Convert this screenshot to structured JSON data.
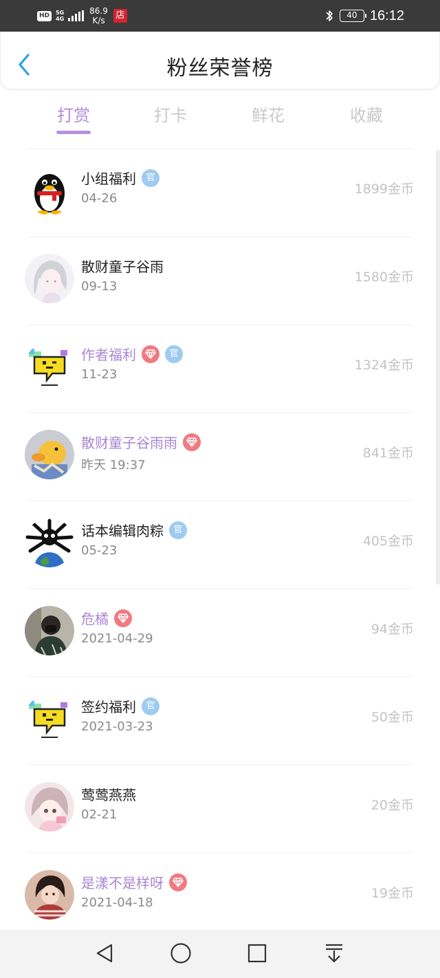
{
  "status_bar": {
    "hd": "HD",
    "network_type": "5G",
    "network_sub": "4G",
    "speed_value": "86.9",
    "speed_unit": "K/s",
    "shop_badge": "店",
    "battery": "40",
    "time": "16:12"
  },
  "header": {
    "title": "粉丝荣誉榜",
    "back_icon": "chevron-left-icon"
  },
  "tabs": [
    {
      "label": "打赏",
      "active": true
    },
    {
      "label": "打卡",
      "active": false
    },
    {
      "label": "鲜花",
      "active": false
    },
    {
      "label": "收藏",
      "active": false
    }
  ],
  "badges": {
    "guan": "官"
  },
  "colors": {
    "accent": "#b08bd9",
    "vip_name": "#a985d4",
    "guan_badge": "#9ecbf0",
    "diamond_badge": "#f07a80"
  },
  "fans": [
    {
      "name": "小组福利",
      "date": "04-26",
      "amount": "1899金币",
      "vip": false,
      "guan": true,
      "diamond": false,
      "avatar": "penguin-avatar"
    },
    {
      "name": "散财童子谷雨",
      "date": "09-13",
      "amount": "1580金币",
      "vip": false,
      "guan": false,
      "diamond": false,
      "avatar": "anime-girl-avatar"
    },
    {
      "name": "作者福利",
      "date": "11-23",
      "amount": "1324金币",
      "vip": true,
      "guan": true,
      "diamond": true,
      "avatar": "yellow-sign-avatar"
    },
    {
      "name": "散财童子谷雨雨",
      "date": "昨天 19:37",
      "amount": "841金币",
      "vip": true,
      "guan": false,
      "diamond": true,
      "avatar": "duck-avatar"
    },
    {
      "name": "话本编辑肉粽",
      "date": "05-23",
      "amount": "405金币",
      "vip": false,
      "guan": true,
      "diamond": false,
      "avatar": "globe-creature-avatar"
    },
    {
      "name": "危橘",
      "date": "2021-04-29",
      "amount": "94金币",
      "vip": true,
      "guan": false,
      "diamond": true,
      "avatar": "person-photo-avatar"
    },
    {
      "name": "签约福利",
      "date": "2021-03-23",
      "amount": "50金币",
      "vip": false,
      "guan": true,
      "diamond": false,
      "avatar": "yellow-sign-avatar"
    },
    {
      "name": "莺莺燕燕",
      "date": "02-21",
      "amount": "20金币",
      "vip": false,
      "guan": false,
      "diamond": false,
      "avatar": "anime-pink-avatar"
    },
    {
      "name": "是漾不是样呀",
      "date": "2021-04-18",
      "amount": "19金币",
      "vip": true,
      "guan": false,
      "diamond": true,
      "avatar": "person-striped-avatar"
    }
  ],
  "nav": [
    "back-triangle-icon",
    "home-circle-icon",
    "recents-square-icon",
    "notification-pull-icon"
  ]
}
